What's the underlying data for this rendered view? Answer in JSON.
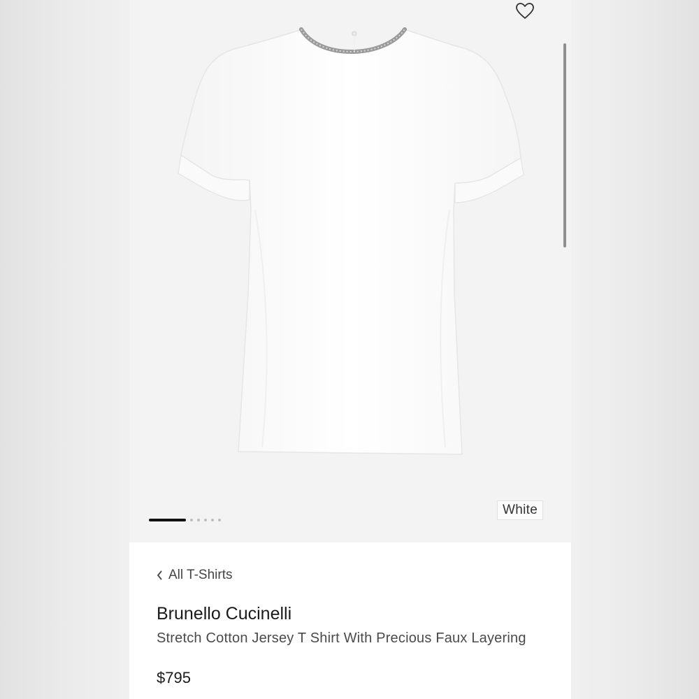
{
  "product": {
    "brand": "Brunello Cucinelli",
    "title": "Stretch Cotton Jersey T Shirt With Precious Faux Layering",
    "price": "$795",
    "color": "White"
  },
  "navigation": {
    "back_label": "All T-Shirts"
  },
  "gallery": {
    "current_image": 1,
    "image_count": 6
  },
  "icons": {
    "wishlist": "heart-outline-icon",
    "back": "chevron-left-icon"
  },
  "colors": {
    "gallery_bg": "#f3f3f3",
    "text_primary": "#1a1a1a",
    "indicator_active": "#111111"
  }
}
